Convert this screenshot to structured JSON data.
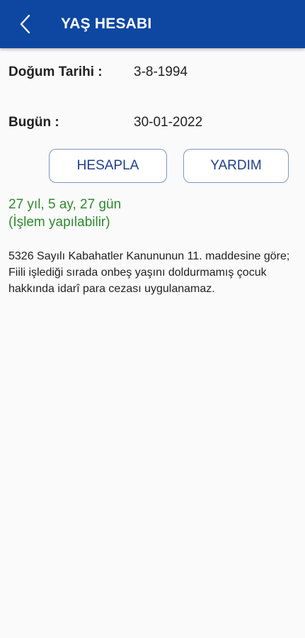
{
  "appbar": {
    "title": "YAŞ HESABI",
    "back_icon": "chevron-left-icon",
    "color": "#0d47a1"
  },
  "form": {
    "birth_label": "Doğum Tarihi :",
    "birth_value": "3-8-1994",
    "today_label": "Bugün :",
    "today_value": "30-01-2022"
  },
  "buttons": {
    "calculate": "HESAPLA",
    "help": "YARDIM"
  },
  "result": {
    "age_text": "27 yıl, 5 ay, 27 gün",
    "status_text": "(İşlem yapılabilir)",
    "color": "#2e8b2e"
  },
  "legal_note": "5326 Sayılı Kabahatler Kanununun 11. maddesine göre; Fiili işlediği sırada onbeş yaşını doldurmamış çocuk hakkında idarî para cezası uygulanamaz."
}
